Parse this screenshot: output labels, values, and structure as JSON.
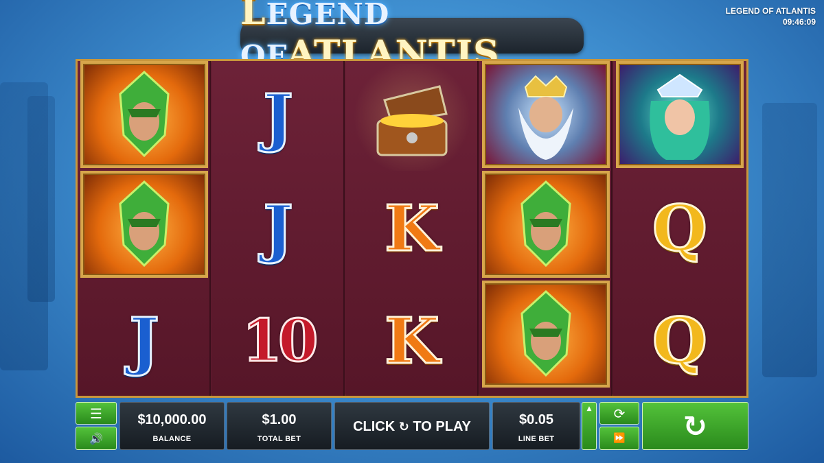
{
  "header": {
    "game_title": "LEGEND OF ATLANTIS",
    "clock": "09:46:09",
    "logo_small_words": "EGEND OF",
    "logo_l": "L",
    "logo_big": "ATLANTIS"
  },
  "reels": [
    {
      "symbols": [
        "hero",
        "hero",
        "J"
      ]
    },
    {
      "symbols": [
        "J",
        "J",
        "10"
      ]
    },
    {
      "symbols": [
        "chest",
        "K",
        "K"
      ]
    },
    {
      "symbols": [
        "king",
        "hero",
        "hero"
      ]
    },
    {
      "symbols": [
        "queen",
        "Q",
        "Q"
      ]
    }
  ],
  "symbol_letters": {
    "J": "J",
    "K": "K",
    "Q": "Q",
    "ten": "10"
  },
  "controls": {
    "menu_icon": "☰",
    "sound_icon": "🔊",
    "balance_value": "$10,000.00",
    "balance_label": "BALANCE",
    "total_bet_value": "$1.00",
    "total_bet_label": "TOTAL BET",
    "click_prefix": "CLICK",
    "click_icon": "↻",
    "click_suffix": "TO PLAY",
    "line_bet_value": "$0.05",
    "line_bet_label": "LINE BET",
    "up_icon": "▲",
    "autoplay_icon": "⟳",
    "turbo_icon": "⏩",
    "spin_icon": "↻"
  },
  "colors": {
    "reel_bg": "#5e1a2e",
    "frame_gold": "#c8963c",
    "button_green": "#3aa62a"
  }
}
